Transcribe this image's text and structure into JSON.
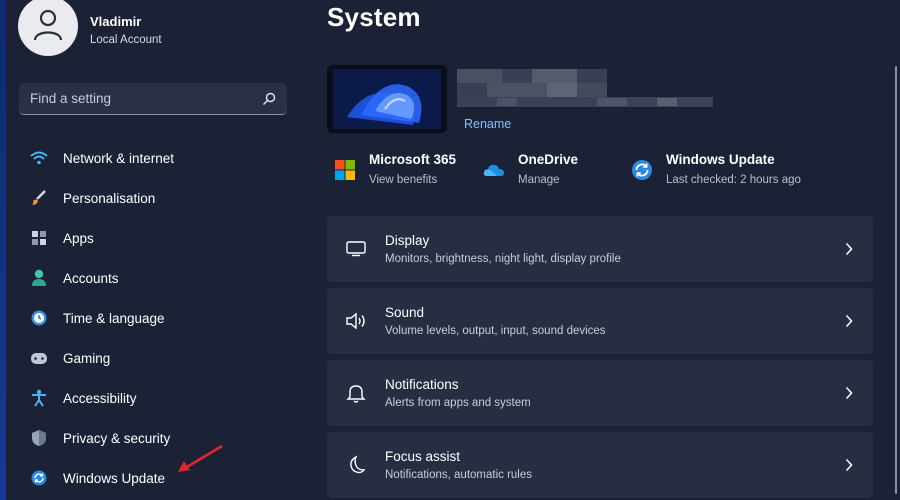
{
  "user": {
    "name": "Vladimir",
    "account_type": "Local Account"
  },
  "search": {
    "placeholder": "Find a setting"
  },
  "sidebar": {
    "items": [
      {
        "label": "Network & internet",
        "icon": "wifi-icon"
      },
      {
        "label": "Personalisation",
        "icon": "brush-icon"
      },
      {
        "label": "Apps",
        "icon": "apps-icon"
      },
      {
        "label": "Accounts",
        "icon": "person-icon"
      },
      {
        "label": "Time & language",
        "icon": "clock-globe-icon"
      },
      {
        "label": "Gaming",
        "icon": "gamepad-icon"
      },
      {
        "label": "Accessibility",
        "icon": "accessibility-icon"
      },
      {
        "label": "Privacy & security",
        "icon": "shield-icon"
      },
      {
        "label": "Windows Update",
        "icon": "update-icon"
      }
    ]
  },
  "main": {
    "title": "System",
    "device": {
      "rename_label": "Rename"
    },
    "quick_links": [
      {
        "title": "Microsoft 365",
        "subtitle": "View benefits",
        "icon": "microsoft-365-icon"
      },
      {
        "title": "OneDrive",
        "subtitle": "Manage",
        "icon": "onedrive-icon"
      },
      {
        "title": "Windows Update",
        "subtitle": "Last checked: 2 hours ago",
        "icon": "windows-update-icon"
      }
    ],
    "cards": [
      {
        "title": "Display",
        "subtitle": "Monitors, brightness, night light, display profile",
        "icon": "display-icon"
      },
      {
        "title": "Sound",
        "subtitle": "Volume levels, output, input, sound devices",
        "icon": "speaker-icon"
      },
      {
        "title": "Notifications",
        "subtitle": "Alerts from apps and system",
        "icon": "bell-icon"
      },
      {
        "title": "Focus assist",
        "subtitle": "Notifications, automatic rules",
        "icon": "moon-icon"
      }
    ]
  },
  "colors": {
    "accent": "#7ec3f6",
    "background": "#1b2236",
    "card": "#272e42",
    "arrow": "#e0262e"
  }
}
